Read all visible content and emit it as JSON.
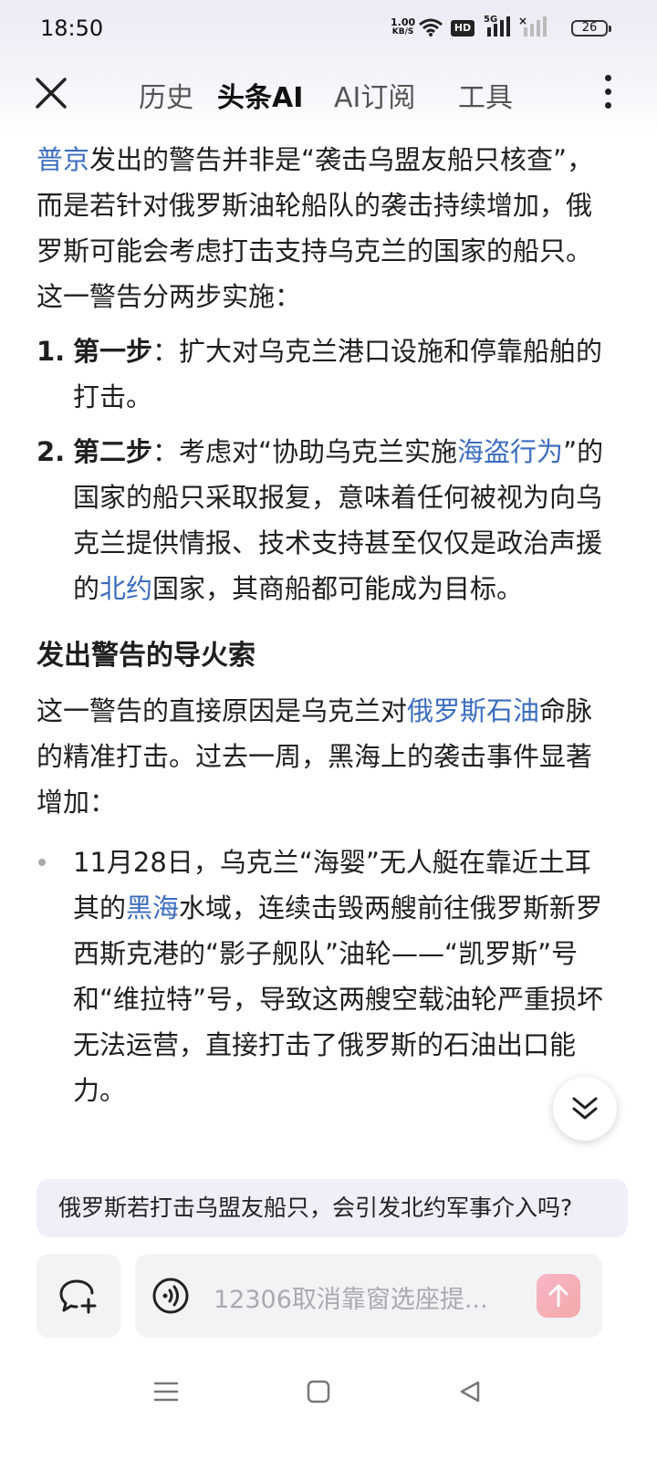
{
  "status_bar": {
    "time": "18:50",
    "net_speed": "1.00",
    "net_unit": "KB/S",
    "hd_label": "HD",
    "sig_label": "5G",
    "battery": "26"
  },
  "nav": {
    "tabs": [
      {
        "label": "历史"
      },
      {
        "label": "头条AI"
      },
      {
        "label": "AI订阅"
      },
      {
        "label": "工具"
      }
    ],
    "active_tab": "头条AI"
  },
  "article": {
    "intro_link": "普京",
    "intro_text": "发出的警告并非是“袭击乌盟友船只核查”，而是若针对俄罗斯油轮船队的袭击持续增加，俄罗斯可能会考虑打击支持乌克兰的国家的船只。这一警告分两步实施：",
    "steps": [
      {
        "num": "1.",
        "title": "第一步",
        "text_a": "：扩大对乌克兰港口设施和停靠船舶的打击。",
        "link": "",
        "text_b": "",
        "link2": "",
        "text_c": ""
      },
      {
        "num": "2.",
        "title": "第二步",
        "text_a": "：考虑对“协助乌克兰实施",
        "link": "海盗行为",
        "text_b": "”的国家的船只采取报复，意味着任何被视为向乌克兰提供情报、技术支持甚至仅仅是政治声援的",
        "link2": "北约",
        "text_c": "国家，其商船都可能成为目标。"
      }
    ],
    "section_heading": "发出警告的导火索",
    "para_a": "这一警告的直接原因是乌克兰对",
    "para_link": "俄罗斯石油",
    "para_b": "命脉的精准打击。过去一周，黑海上的袭击事件显著增加：",
    "bullet_a": "11月28日，乌克兰“海婴”无人艇在靠近土耳其的",
    "bullet_link": "黑海",
    "bullet_b": "水域，连续击毁两艘前往俄罗斯新罗西斯克港的“影子舰队”油轮——“凯罗斯”号和“维拉特”号，导致这两艘空载油轮严重损坏无法运营，直接打击了俄罗斯的石油出口能力。"
  },
  "suggestion": "俄罗斯若打击乌盟友船只，会引发北约军事介入吗?",
  "input": {
    "placeholder": "12306取消靠窗选座提..."
  },
  "colors": {
    "link": "#3b6cc0",
    "suggest_bg": "#efeff8",
    "send_gradient": "#f7b6c6"
  }
}
